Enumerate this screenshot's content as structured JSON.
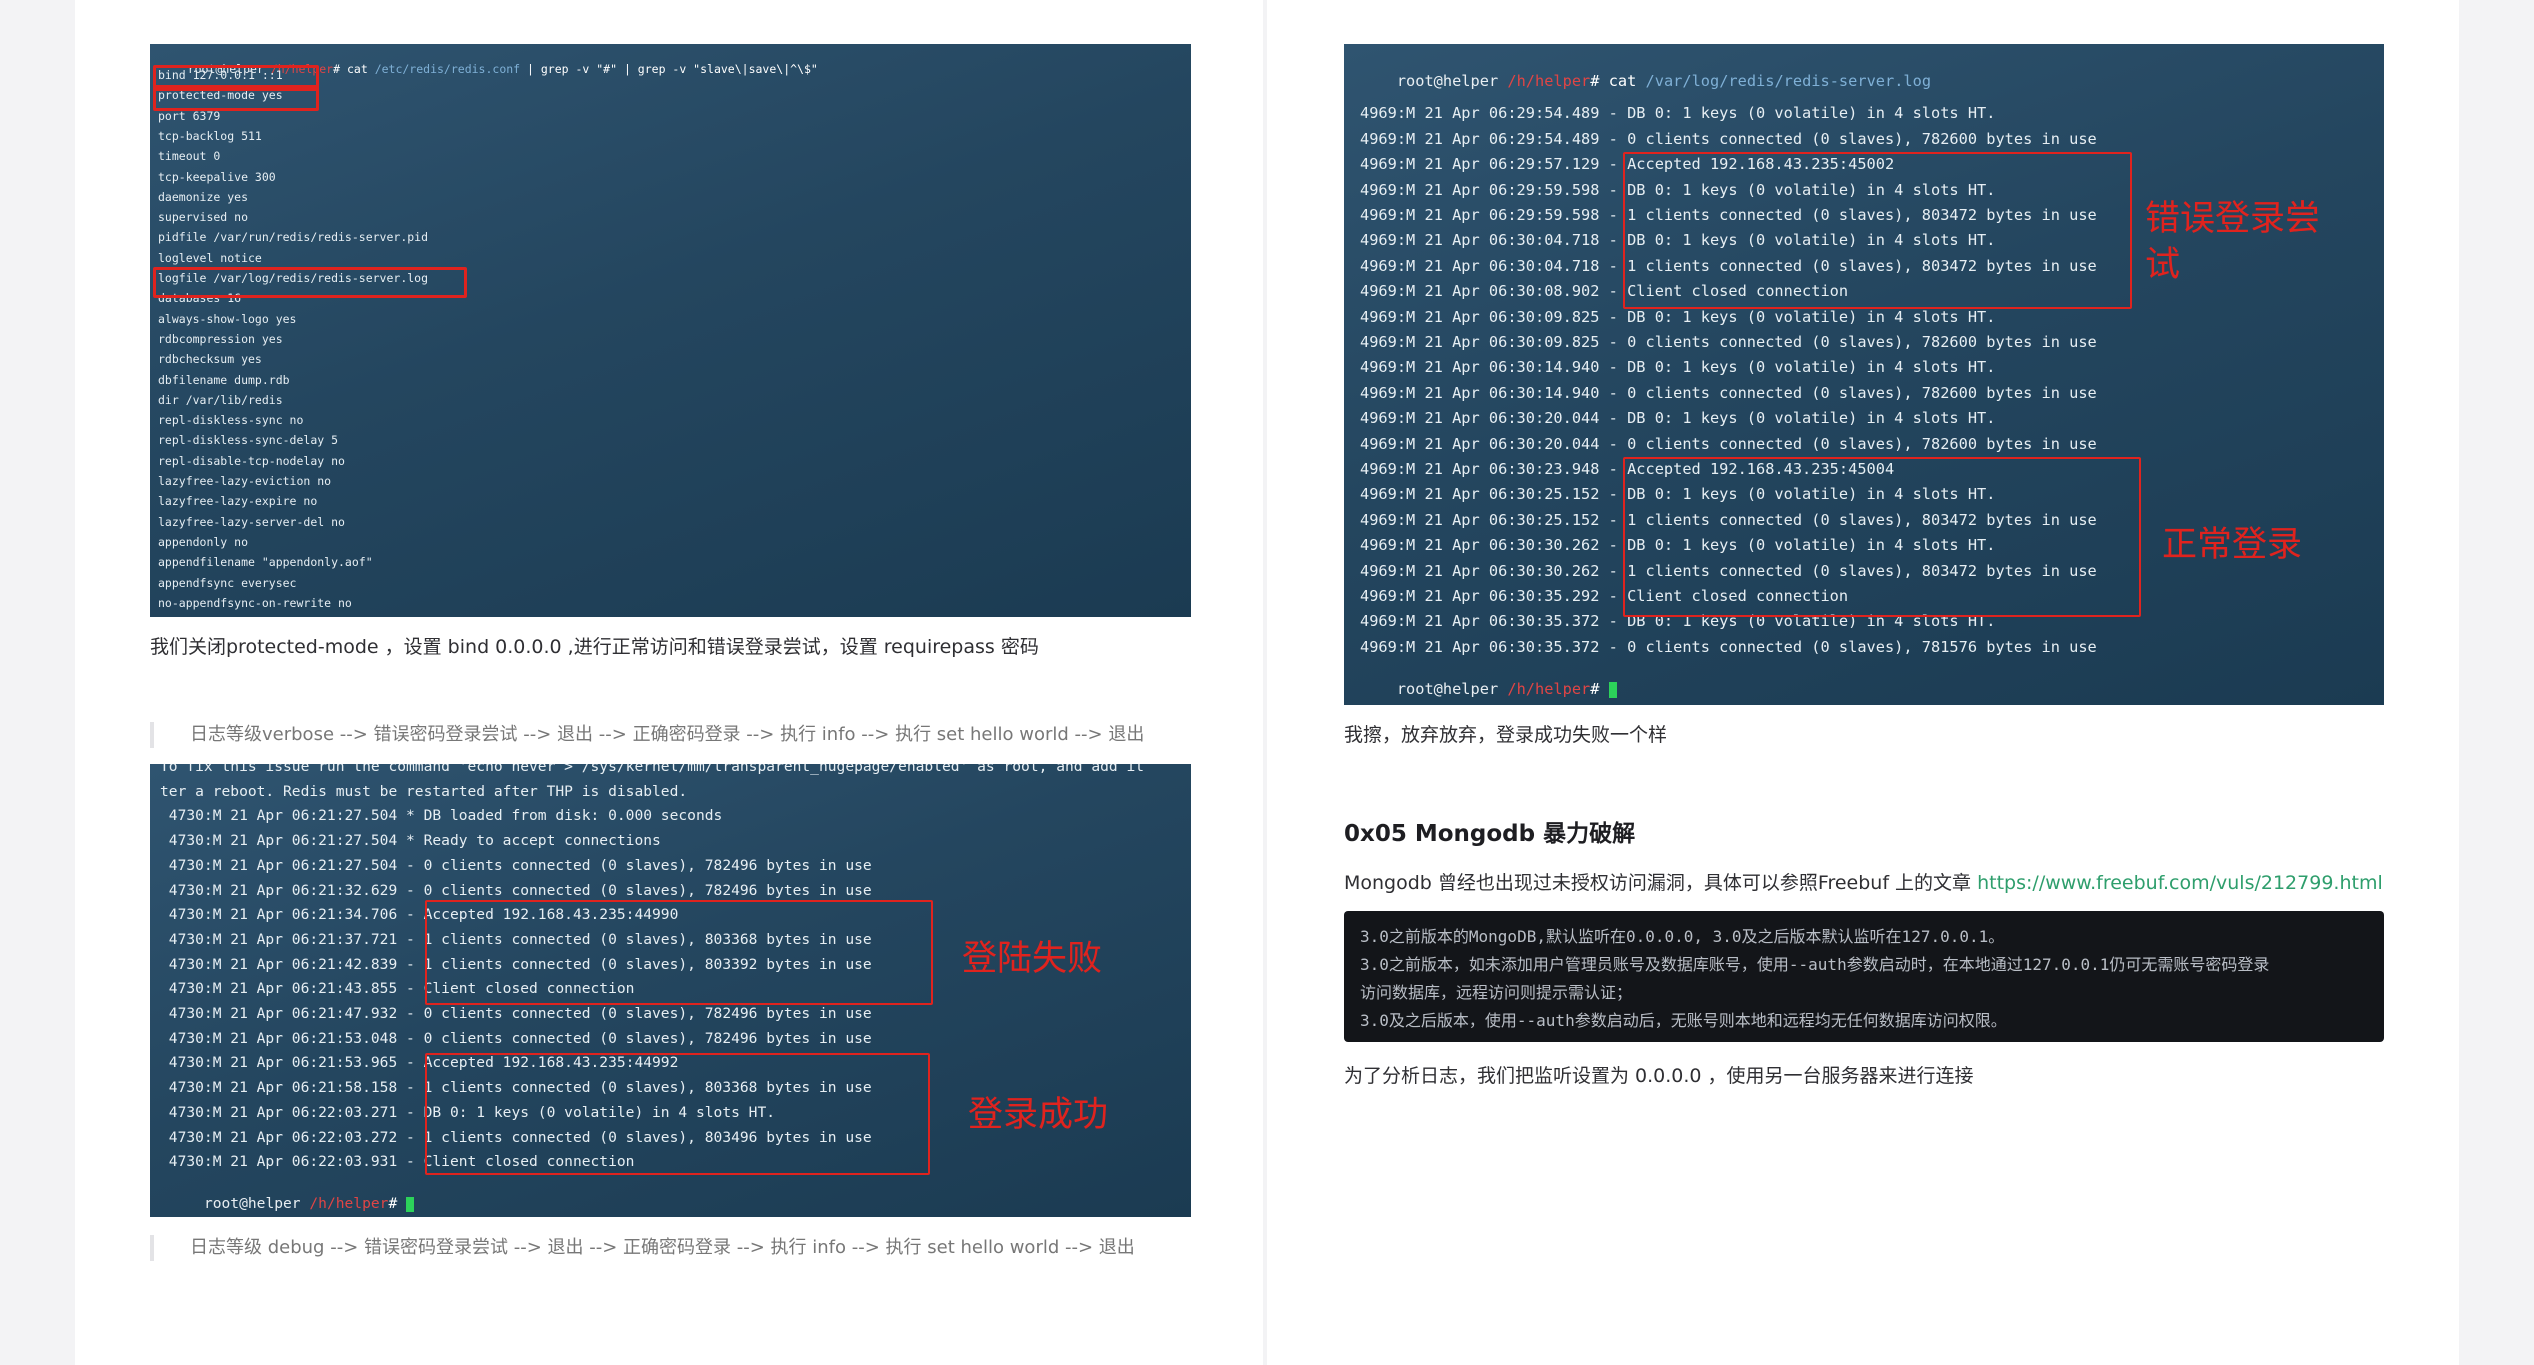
{
  "left": {
    "term1": {
      "prompt": {
        "user": "root@helper",
        "path": " /h/helper",
        "suffix": "# ",
        "cmd": "cat",
        "arg": " /etc/redis/redis.conf",
        "rest": " | grep -v \"#\" | grep -v \"slave\\|save\\|^\\$\""
      },
      "lines": [
        "bind 127.0.0.1 ::1",
        "protected-mode yes",
        "port 6379",
        "tcp-backlog 511",
        "timeout 0",
        "tcp-keepalive 300",
        "daemonize yes",
        "supervised no",
        "pidfile /var/run/redis/redis-server.pid",
        "loglevel notice",
        "logfile /var/log/redis/redis-server.log",
        "databases 16",
        "always-show-logo yes",
        "rdbcompression yes",
        "rdbchecksum yes",
        "dbfilename dump.rdb",
        "dir /var/lib/redis",
        "repl-diskless-sync no",
        "repl-diskless-sync-delay 5",
        "repl-disable-tcp-nodelay no",
        "lazyfree-lazy-eviction no",
        "lazyfree-lazy-expire no",
        "lazyfree-lazy-server-del no",
        "appendonly no",
        "appendfilename \"appendonly.aof\"",
        "appendfsync everysec",
        "no-appendfsync-on-rewrite no"
      ]
    },
    "para1": "我们关闭protected-mode ，设置 bind 0.0.0.0 ,进行正常访问和错误登录尝试，设置 requirepass 密码",
    "quote1": "日志等级verbose --> 错误密码登录尝试 --> 退出 --> 正确密码登录 --> 执行 info --> 执行 set hello world --> 退出",
    "term2": {
      "lines": [
        "To fix this issue run the command 'echo never > /sys/kernel/mm/transparent_hugepage/enabled' as root, and add it",
        "ter a reboot. Redis must be restarted after THP is disabled.",
        " 4730:M 21 Apr 06:21:27.504 * DB loaded from disk: 0.000 seconds",
        " 4730:M 21 Apr 06:21:27.504 * Ready to accept connections",
        " 4730:M 21 Apr 06:21:27.504 - 0 clients connected (0 slaves), 782496 bytes in use",
        " 4730:M 21 Apr 06:21:32.629 - 0 clients connected (0 slaves), 782496 bytes in use",
        " 4730:M 21 Apr 06:21:34.706 - Accepted 192.168.43.235:44990",
        " 4730:M 21 Apr 06:21:37.721 - 1 clients connected (0 slaves), 803368 bytes in use",
        " 4730:M 21 Apr 06:21:42.839 - 1 clients connected (0 slaves), 803392 bytes in use",
        " 4730:M 21 Apr 06:21:43.855 - Client closed connection",
        " 4730:M 21 Apr 06:21:47.932 - 0 clients connected (0 slaves), 782496 bytes in use",
        " 4730:M 21 Apr 06:21:53.048 - 0 clients connected (0 slaves), 782496 bytes in use",
        " 4730:M 21 Apr 06:21:53.965 - Accepted 192.168.43.235:44992",
        " 4730:M 21 Apr 06:21:58.158 - 1 clients connected (0 slaves), 803368 bytes in use",
        " 4730:M 21 Apr 06:22:03.271 - DB 0: 1 keys (0 volatile) in 4 slots HT.",
        " 4730:M 21 Apr 06:22:03.272 - 1 clients connected (0 slaves), 803496 bytes in use",
        " 4730:M 21 Apr 06:22:03.931 - Client closed connection"
      ],
      "prompt": {
        "user": " root@helper",
        "path": " /h/helper",
        "suffix": "# "
      },
      "anno_fail": "登陆失败",
      "anno_success": "登录成功"
    },
    "quote2": "日志等级 debug --> 错误密码登录尝试 --> 退出 --> 正确密码登录 --> 执行 info --> 执行 set hello world --> 退出"
  },
  "right": {
    "term3": {
      "prompt": {
        "user": "root@helper",
        "path": " /h/helper",
        "suffix": "# ",
        "cmd": "cat",
        "arg": " /var/log/redis/redis-server.log"
      },
      "lines": [
        "",
        "4969:M 21 Apr 06:29:54.489 - DB 0: 1 keys (0 volatile) in 4 slots HT.",
        "4969:M 21 Apr 06:29:54.489 - 0 clients connected (0 slaves), 782600 bytes in use",
        "4969:M 21 Apr 06:29:57.129 - Accepted 192.168.43.235:45002",
        "4969:M 21 Apr 06:29:59.598 - DB 0: 1 keys (0 volatile) in 4 slots HT.",
        "4969:M 21 Apr 06:29:59.598 - 1 clients connected (0 slaves), 803472 bytes in use",
        "4969:M 21 Apr 06:30:04.718 - DB 0: 1 keys (0 volatile) in 4 slots HT.",
        "4969:M 21 Apr 06:30:04.718 - 1 clients connected (0 slaves), 803472 bytes in use",
        "4969:M 21 Apr 06:30:08.902 - Client closed connection",
        "4969:M 21 Apr 06:30:09.825 - DB 0: 1 keys (0 volatile) in 4 slots HT.",
        "4969:M 21 Apr 06:30:09.825 - 0 clients connected (0 slaves), 782600 bytes in use",
        "4969:M 21 Apr 06:30:14.940 - DB 0: 1 keys (0 volatile) in 4 slots HT.",
        "4969:M 21 Apr 06:30:14.940 - 0 clients connected (0 slaves), 782600 bytes in use",
        "4969:M 21 Apr 06:30:20.044 - DB 0: 1 keys (0 volatile) in 4 slots HT.",
        "4969:M 21 Apr 06:30:20.044 - 0 clients connected (0 slaves), 782600 bytes in use",
        "4969:M 21 Apr 06:30:23.948 - Accepted 192.168.43.235:45004",
        "4969:M 21 Apr 06:30:25.152 - DB 0: 1 keys (0 volatile) in 4 slots HT.",
        "4969:M 21 Apr 06:30:25.152 - 1 clients connected (0 slaves), 803472 bytes in use",
        "4969:M 21 Apr 06:30:30.262 - DB 0: 1 keys (0 volatile) in 4 slots HT.",
        "4969:M 21 Apr 06:30:30.262 - 1 clients connected (0 slaves), 803472 bytes in use",
        "4969:M 21 Apr 06:30:35.292 - Client closed connection",
        "4969:M 21 Apr 06:30:35.372 - DB 0: 1 keys (0 volatile) in 4 slots HT.",
        "4969:M 21 Apr 06:30:35.372 - 0 clients connected (0 slaves), 781576 bytes in use"
      ],
      "prompt_end": {
        "user": "root@helper",
        "path": " /h/helper",
        "suffix": "# "
      },
      "anno_error": "错误登录尝\n试",
      "anno_normal": "正常登录"
    },
    "para1": "我擦，放弃放弃，登录成功失败一个样",
    "heading": "0x05 Mongodb 暴力破解",
    "para2_text": "Mongodb 曾经也出现过未授权访问漏洞，具体可以参照Freebuf 上的文章 ",
    "para2_link": "https://www.freebuf.com/vuls/212799.html",
    "code_lines": [
      "3.0之前版本的MongoDB,默认监听在0.0.0.0, 3.0及之后版本默认监听在127.0.0.1。",
      "3.0之前版本，如未添加用户管理员账号及数据库账号，使用--auth参数启动时，在本地通过127.0.0.1仍可无需账号密码登录",
      "访问数据库，远程访问则提示需认证；",
      "3.0及之后版本，使用--auth参数启动后，无账号则本地和远程均无任何数据库访问权限。"
    ],
    "para3": "为了分析日志，我们把监听设置为 0.0.0.0 ，使用另一台服务器来进行连接"
  }
}
